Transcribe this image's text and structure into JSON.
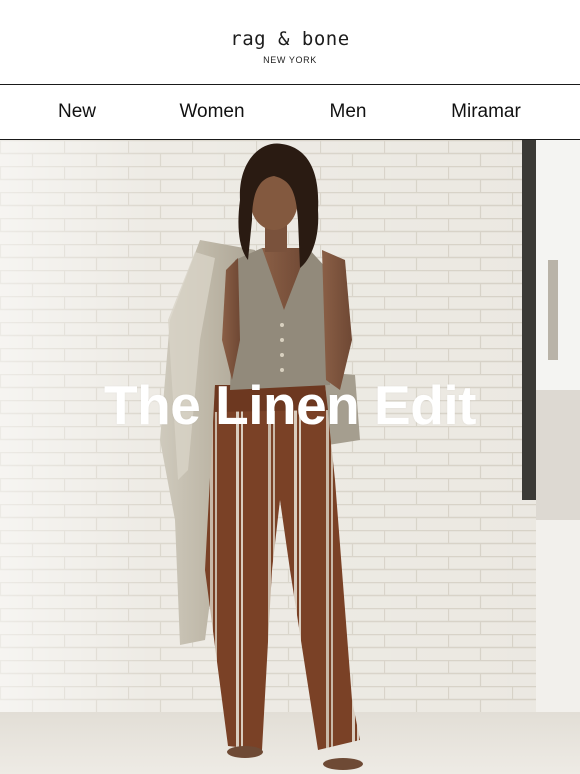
{
  "brand": {
    "name": "rag & bone",
    "location": "NEW YORK"
  },
  "nav": {
    "items": [
      {
        "label": "New"
      },
      {
        "label": "Women"
      },
      {
        "label": "Men"
      },
      {
        "label": "Miramar"
      }
    ]
  },
  "hero": {
    "title": "The Linen Edit"
  },
  "colors": {
    "text": "#111111",
    "divider": "#1a1a1a",
    "hero_title": "#ffffff",
    "brick_wall": "#e9e6df",
    "trousers": "#7a4126"
  }
}
